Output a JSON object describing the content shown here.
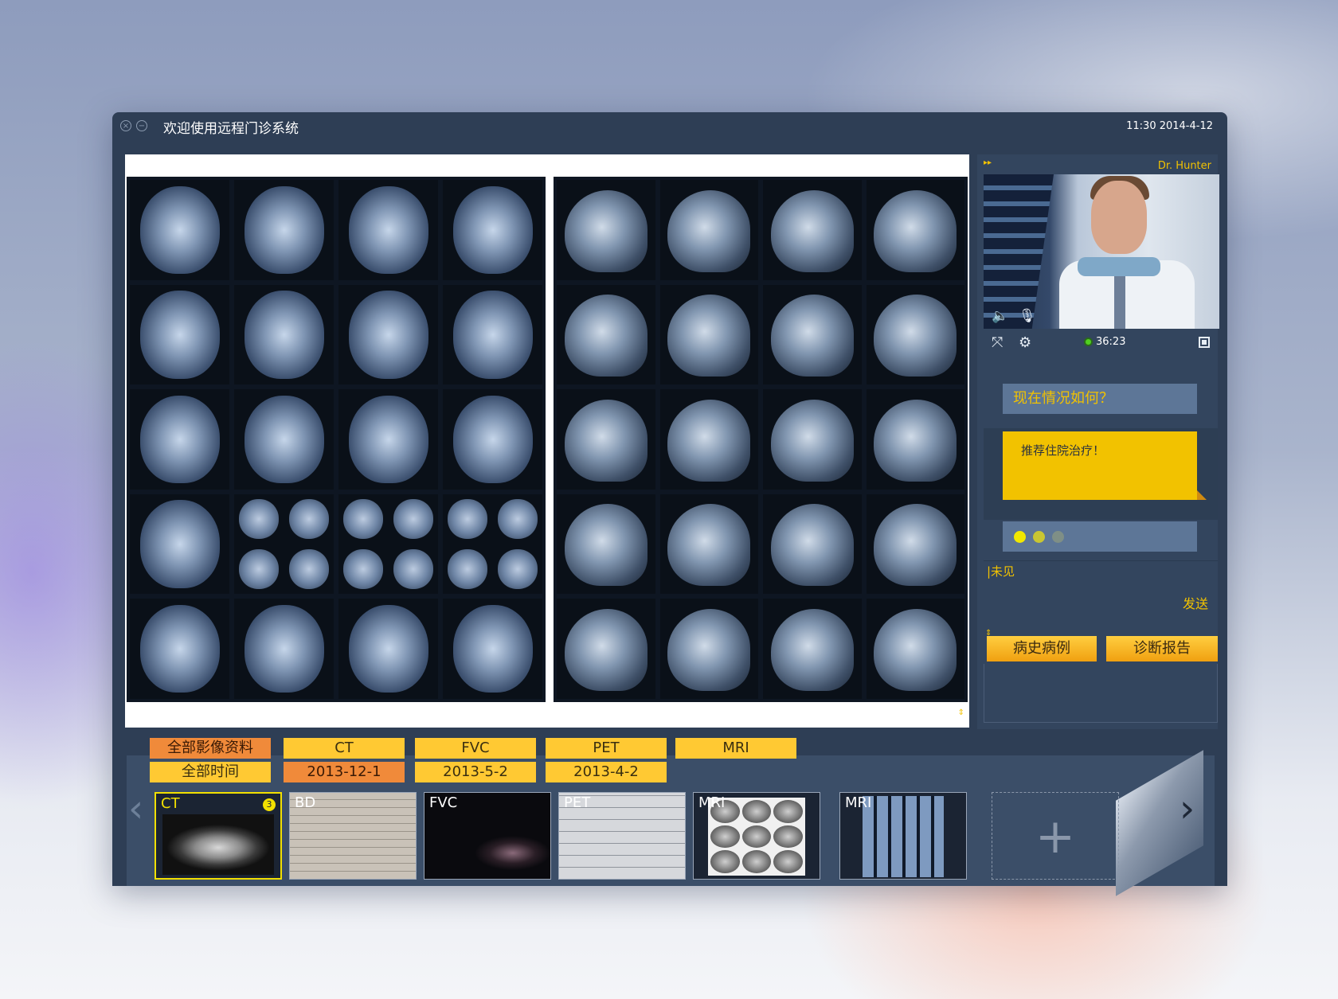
{
  "window": {
    "title": "欢迎使用远程门诊系统",
    "clock": "11:30  2014-4-12"
  },
  "video": {
    "doctor_name": "Dr. Hunter",
    "call_time": "36:23"
  },
  "chat": {
    "question": "现在情况如何？",
    "reply": "推荐住院治疗！",
    "input_text": "|未见",
    "send_label": "发送"
  },
  "actions": {
    "history_label": "病史病例",
    "report_label": "诊断报告"
  },
  "filters": {
    "categories": [
      "全部影像资料",
      "CT",
      "FVC",
      "PET",
      "MRI"
    ],
    "dates": [
      "全部时间",
      "2013-12-1",
      "2013-5-2",
      "2013-4-2"
    ]
  },
  "thumbnails": [
    {
      "label": "CT",
      "badge": "3"
    },
    {
      "label": "BD"
    },
    {
      "label": "FVC"
    },
    {
      "label": "PET"
    },
    {
      "label": "MRI"
    },
    {
      "label": "MRI"
    }
  ],
  "icons": {
    "window_close": "close-icon",
    "window_minimize": "minimize-icon",
    "tools": [
      "pen-icon",
      "rectangle-select-icon",
      "fill-icon",
      "eraser-icon",
      "text-icon",
      "undo-arrow-icon",
      "redo-arrow-icon",
      "refresh-icon",
      "trash-icon"
    ],
    "video_controls": [
      "fullscreen-icon",
      "settings-icon",
      "speaker-icon",
      "microphone-icon",
      "stop-icon"
    ],
    "add": "plus-icon"
  },
  "colors": {
    "accent_yellow": "#f2c200",
    "accent_orange": "#f08a3a",
    "window_bg": "#2e3e55",
    "palette": [
      "#000000",
      "#7f7f7f",
      "#f4a400",
      "#f7c800",
      "#22c21e",
      "#2a8c2a",
      "#e6341c",
      "#a01010",
      "#e020e0",
      "#1aa05a",
      "#1a60d8",
      "#102ea0"
    ]
  }
}
